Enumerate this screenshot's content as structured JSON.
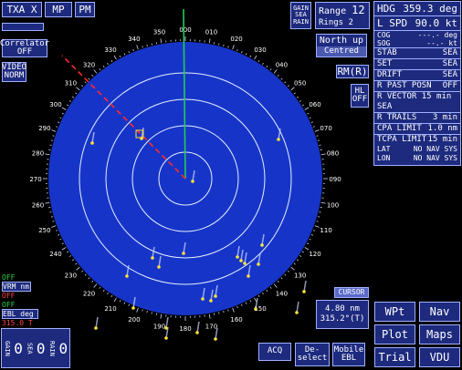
{
  "top_left": {
    "txa": "TXA X",
    "mp": "MP",
    "pm": "PM"
  },
  "left": {
    "correlator": [
      "Correlator",
      "OFF"
    ],
    "video": [
      "VIDEO",
      "NORM"
    ],
    "vrm": {
      "state": "OFF",
      "label": "VRM nm",
      "value": "OFF"
    },
    "ebl": {
      "state": "OFF",
      "label": "EBL deg",
      "value": "315.0 T"
    },
    "bottom": {
      "gain_label": "GAIN",
      "gain_value": "0",
      "sea_label": "SEA",
      "sea_value": "0",
      "rain_label": "RAIN",
      "rain_value": "0"
    }
  },
  "top_center": {
    "gsr": [
      "GAIN",
      "SEA",
      "RAIN"
    ],
    "range_label": "Range",
    "range_value": "12",
    "rings_label": "Rings",
    "rings_value": "2",
    "north_up": "North up",
    "centred": "Centred",
    "rm": "RM(R)",
    "hl": [
      "HL",
      "OFF"
    ]
  },
  "info": {
    "hdg_label": "HDG",
    "hdg_value": "359.3 deg",
    "spd_label": "L SPD",
    "spd_value": "90.0 kt",
    "cog_label": "COG",
    "cog_value": "---.- deg",
    "sog_label": "SOG",
    "sog_value": "--.- kt",
    "rows": [
      {
        "k": "STAB",
        "v": "SEA"
      },
      {
        "k": "SET",
        "v": "SEA"
      },
      {
        "k": "DRIFT",
        "v": "SEA"
      },
      {
        "k": "R PAST POSN",
        "v": "OFF"
      },
      {
        "k": "R VECTOR 15 min SEA",
        "v": ""
      },
      {
        "k": "R TRAILS",
        "v": "3 min"
      },
      {
        "k": "CPA LIMIT",
        "v": "1.0 nm"
      },
      {
        "k": "TCPA LIMIT",
        "v": "15 min"
      }
    ],
    "lat_label": "LAT",
    "lat_value": "NO NAV SYS",
    "lon_label": "LON",
    "lon_value": "NO NAV SYS"
  },
  "cursor": {
    "label": "CURSOR",
    "range": "4.80 nm",
    "bearing": "315.2°(T)"
  },
  "right_buttons": {
    "wpt": "WPt",
    "nav": "Nav",
    "plot": "Plot",
    "maps": "Maps",
    "trial": "Trial",
    "vdu": "VDU"
  },
  "bottom_buttons": {
    "acq": "ACQ",
    "deselect": [
      "De-",
      "select"
    ],
    "mobile_ebl": [
      "Mobile",
      "EBL"
    ]
  },
  "bearing_scale": [
    "000",
    "010",
    "020",
    "030",
    "040",
    "050",
    "060",
    "070",
    "080",
    "090",
    "100",
    "110",
    "120",
    "130",
    "140",
    "150",
    "160",
    "170",
    "180",
    "190",
    "200",
    "210",
    "220",
    "230",
    "240",
    "250",
    "260",
    "270",
    "280",
    "290",
    "300",
    "310",
    "320",
    "330",
    "340",
    "350"
  ],
  "colors": {
    "panel": "#1d2a7e",
    "radar_bg": "#1635c8",
    "ring": "#e8eeff",
    "heading_line": "#22cc55",
    "ebl_line": "#ff2a2a",
    "target": "#ffe23a"
  }
}
